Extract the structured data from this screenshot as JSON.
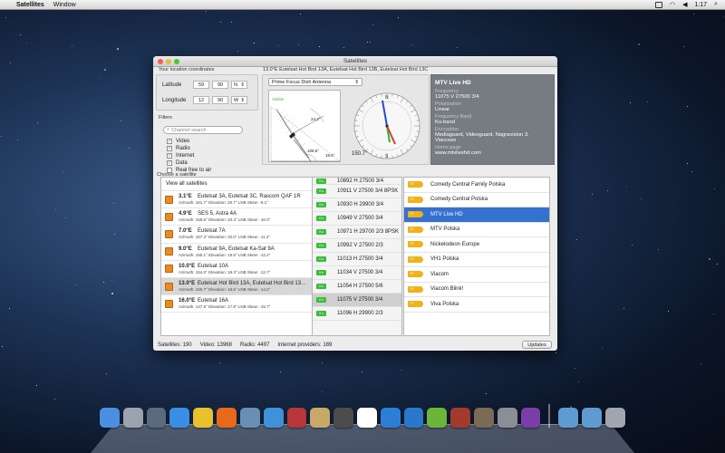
{
  "menubar": {
    "app_name": "Satellites",
    "menu_window": "Window",
    "clock": "1:17"
  },
  "window": {
    "title": "Satellites",
    "current_satellite": "13.0°E Eutelsat Hot Bird 13A, Eutelsat Hot Bird 13B, Eutelsat Hot Bird 13C"
  },
  "location": {
    "section_label": "Your location coordinates",
    "latitude_label": "Latitude",
    "latitude_deg": "59",
    "latitude_min": "90",
    "latitude_dir": "N",
    "longitude_label": "Longitude",
    "longitude_deg": "12",
    "longitude_min": "90",
    "longitude_dir": "W"
  },
  "filters": {
    "section_label": "Filters",
    "search_placeholder": "Channel search",
    "items": [
      {
        "label": "Video",
        "checked": true
      },
      {
        "label": "Radio",
        "checked": true
      },
      {
        "label": "Internet",
        "checked": true
      },
      {
        "label": "Data",
        "checked": true
      },
      {
        "label": "Real free to air",
        "checked": false
      }
    ]
  },
  "dish": {
    "antenna_type": "Prime Focus Dish Antenna",
    "visible_label": "Visible",
    "elevation_angle": "24.2°",
    "azimuth_inner": "108.6°",
    "lnb_angle": "18.6°",
    "compass_reading": "150.7°",
    "compass_n": "N",
    "compass_s": "S"
  },
  "channel_info": {
    "name": "MTV Live HD",
    "frequency_label": "Frequency",
    "frequency": "11075 V 27500 3/4",
    "polarization_label": "Polarization",
    "polarization": "Linear",
    "band_label": "Frequency Band",
    "band": "Ku-band",
    "encryption_label": "Encryption",
    "encryption": "Mediaguard, Videoguard, Nagravision 3, Viaccess",
    "homepage_label": "Home page",
    "homepage": "www.mtvlivehd.com"
  },
  "satellite_list": {
    "section_label": "Choose a satellite",
    "view_all": "View all satellites",
    "items": [
      {
        "deg": "3.1°E",
        "name": "Eutelsat 3A, Eutelsat 3C, Rascom QAF 1R",
        "details": "Azimuth: 161.7°   Elevation: 20.7°   LNB Skew: -9.1°",
        "selected": false
      },
      {
        "deg": "4.9°E",
        "name": "SES 5, Astra 4A",
        "details": "Azimuth: 159.6°   Elevation: 20.4°   LNB Skew: -10.0°",
        "selected": false
      },
      {
        "deg": "7.0°E",
        "name": "Eutelsat 7A",
        "details": "Azimuth: 157.3°   Elevation: 20.0°   LNB Skew: -11.2°",
        "selected": false
      },
      {
        "deg": "9.0°E",
        "name": "Eutelsat 9A, Eutelsat Ka-Sat 9A",
        "details": "Azimuth: 155.1°   Elevation: 19.5°   LNB Skew: -12.2°",
        "selected": false
      },
      {
        "deg": "10.0°E",
        "name": "Eutelsat 10A",
        "details": "Azimuth: 154.0°   Elevation: 19.3°   LNB Skew: -12.7°",
        "selected": false
      },
      {
        "deg": "13.0°E",
        "name": "Eutelsat Hot Bird 13A, Eutelsat Hot Bird 13...",
        "details": "Azimuth: 150.7°   Elevation: 18.6°   LNB Skew: -14.2°",
        "selected": true
      },
      {
        "deg": "16.0°E",
        "name": "Eutelsat 16A",
        "details": "Azimuth: 147.5°   Elevation: 17.8°   LNB Skew: -15.7°",
        "selected": false
      }
    ]
  },
  "frequency_list": {
    "badge": "Ku",
    "items": [
      {
        "label": "10892 H 27500 3/4",
        "selected": false
      },
      {
        "label": "10911 V 27500 3/4 8PSK",
        "selected": false
      },
      {
        "label": "10930 H 29900 3/4",
        "selected": false
      },
      {
        "label": "10949 V 27500 3/4",
        "selected": false
      },
      {
        "label": "10971 H 29700 2/3 8PSK",
        "selected": false
      },
      {
        "label": "10992 V 27500 2/3",
        "selected": false
      },
      {
        "label": "11013 H 27500 3/4",
        "selected": false
      },
      {
        "label": "11034 V 27500 3/4",
        "selected": false
      },
      {
        "label": "11054 H 27500 5/6",
        "selected": false
      },
      {
        "label": "11075 V 27500 3/4",
        "selected": true
      },
      {
        "label": "11096 H 29900 2/3",
        "selected": false
      }
    ]
  },
  "channel_list": {
    "badge": "TV",
    "items": [
      {
        "label": "Comedy Central Family Polska",
        "selected": false
      },
      {
        "label": "Comedy Central Polska",
        "selected": false
      },
      {
        "label": "MTV Live HD",
        "selected": true
      },
      {
        "label": "MTV Polska",
        "selected": false
      },
      {
        "label": "Nickelodeon Europe",
        "selected": false
      },
      {
        "label": "VH1 Polska",
        "selected": false
      },
      {
        "label": "Viacom",
        "selected": false
      },
      {
        "label": "Viacom Blink!",
        "selected": false
      },
      {
        "label": "Viva Polska",
        "selected": false
      }
    ]
  },
  "status": {
    "satellites": "Satellites: 190",
    "video": "Video: 13968",
    "radio": "Radio: 4497",
    "internet": "Internet providers: 169",
    "updates_button": "Updates"
  },
  "dock": {
    "icons": [
      {
        "name": "finder-icon",
        "color": "#4a8fe0"
      },
      {
        "name": "launchpad-icon",
        "color": "#9aa3ae"
      },
      {
        "name": "mission-control-icon",
        "color": "#5b6b7d"
      },
      {
        "name": "app-store-icon",
        "color": "#3a8ee6"
      },
      {
        "name": "chrome-icon",
        "color": "#e8c12c"
      },
      {
        "name": "firefox-icon",
        "color": "#e66a1c"
      },
      {
        "name": "preview-icon",
        "color": "#6a8fb5"
      },
      {
        "name": "safari-icon",
        "color": "#3f92d8"
      },
      {
        "name": "photo-booth-icon",
        "color": "#b8373c"
      },
      {
        "name": "contacts-icon",
        "color": "#c9a96a"
      },
      {
        "name": "facetime-icon",
        "color": "#4c4c4c"
      },
      {
        "name": "calendar-icon",
        "color": "#ffffff"
      },
      {
        "name": "itunes-icon",
        "color": "#2d7fd6"
      },
      {
        "name": "xcode-icon",
        "color": "#2b77c9"
      },
      {
        "name": "utorrent-icon",
        "color": "#6ab63a"
      },
      {
        "name": "photo-icon",
        "color": "#a43a2c"
      },
      {
        "name": "image-capture-icon",
        "color": "#7b6a56"
      },
      {
        "name": "settings-icon",
        "color": "#8a8f96"
      },
      {
        "name": "game-icon",
        "color": "#7a3ea8"
      },
      {
        "name": "applications-folder-icon",
        "color": "#5f9bd0"
      },
      {
        "name": "downloads-folder-icon",
        "color": "#5f9bd0"
      },
      {
        "name": "trash-icon",
        "color": "#9fa6ad"
      }
    ]
  }
}
